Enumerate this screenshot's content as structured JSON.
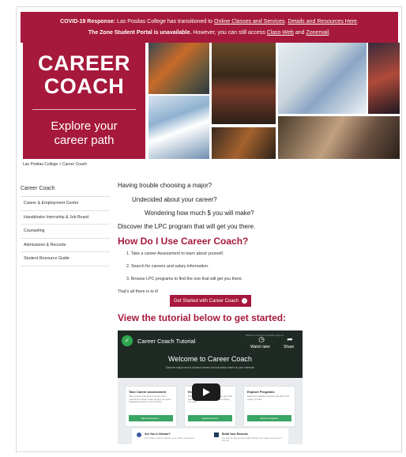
{
  "banner": {
    "line1_bold": "COVID-19 Response:",
    "line1_text": " Las Positas College has transitioned to ",
    "line1_link1": "Online Classes and Services",
    "line1_sep": ". ",
    "line1_link2": "Details and Resources Here",
    "line1_end": ".",
    "line2_bold": "The Zone Student Portal is unavailable.",
    "line2_text": " However, you can still access ",
    "line2_link1": "Class-Web",
    "line2_and": " and ",
    "line2_link2": "Zonemail",
    "line2_end": "."
  },
  "hero": {
    "title_line1": "CAREER",
    "title_line2": "COACH",
    "subtitle_line1": "Explore your",
    "subtitle_line2": "career path"
  },
  "breadcrumb": "Las Positas College > Career Coach",
  "sidebar": {
    "heading": "Career Coach",
    "items": [
      "Career & Employment Center",
      "Handshake Internship & Job Board",
      "Counseling",
      "Admissions & Records",
      "Student Resource Guide"
    ]
  },
  "main": {
    "q1": "Having trouble choosing a major?",
    "q2": "Undecided about your career?",
    "q3": "Wondering how much $ you will make?",
    "q4": "Discover the LPC program that will get you there.",
    "how_heading": "How Do I Use Career Coach?",
    "steps": [
      "1. Take a career Assessment to learn about yourself.",
      "2. Search for careers and salary information.",
      "3. Browse LPC programs to find the one that will get you there."
    ],
    "all_there": "That's all there is to it!",
    "cta_label": "Get Started with Career Coach",
    "tutorial_heading": "View the tutorial below to get started:"
  },
  "video": {
    "title": "Career Coach Tutorial",
    "watch_later": "Watch later",
    "share": "Share",
    "menu": "Welcome   Careers   Programs   Sign In",
    "heading": "Welcome to Career Coach",
    "subheading": "Discover majors and in-demand careers and education based on your interests!",
    "cards": [
      {
        "title": "Take Career Assessment",
        "desc": "Take a Career Assessment to learn about yourself and Career Coach will give you career suggestions based on your interests",
        "button": "Take Assessment →"
      },
      {
        "title": "Explore",
        "desc": "Browse careers and find out what they pay, what education and skills you need and the training you need",
        "button": "Explore Careers"
      },
      {
        "title": "Explore Programs",
        "desc": "Search the available programs that lead to the career you want",
        "button": "Explore Programs"
      }
    ],
    "bottom": [
      {
        "title": "Are You a Veteran?",
        "desc": "Find civilian careers related to your military experience"
      },
      {
        "title": "Build Your Resume",
        "desc": "Our step-by-step resume builder will help you make a resume you can use"
      }
    ]
  },
  "colors": {
    "brand": "#a6193c",
    "video_bg": "#1f2a24",
    "video_green": "#3aa565"
  }
}
